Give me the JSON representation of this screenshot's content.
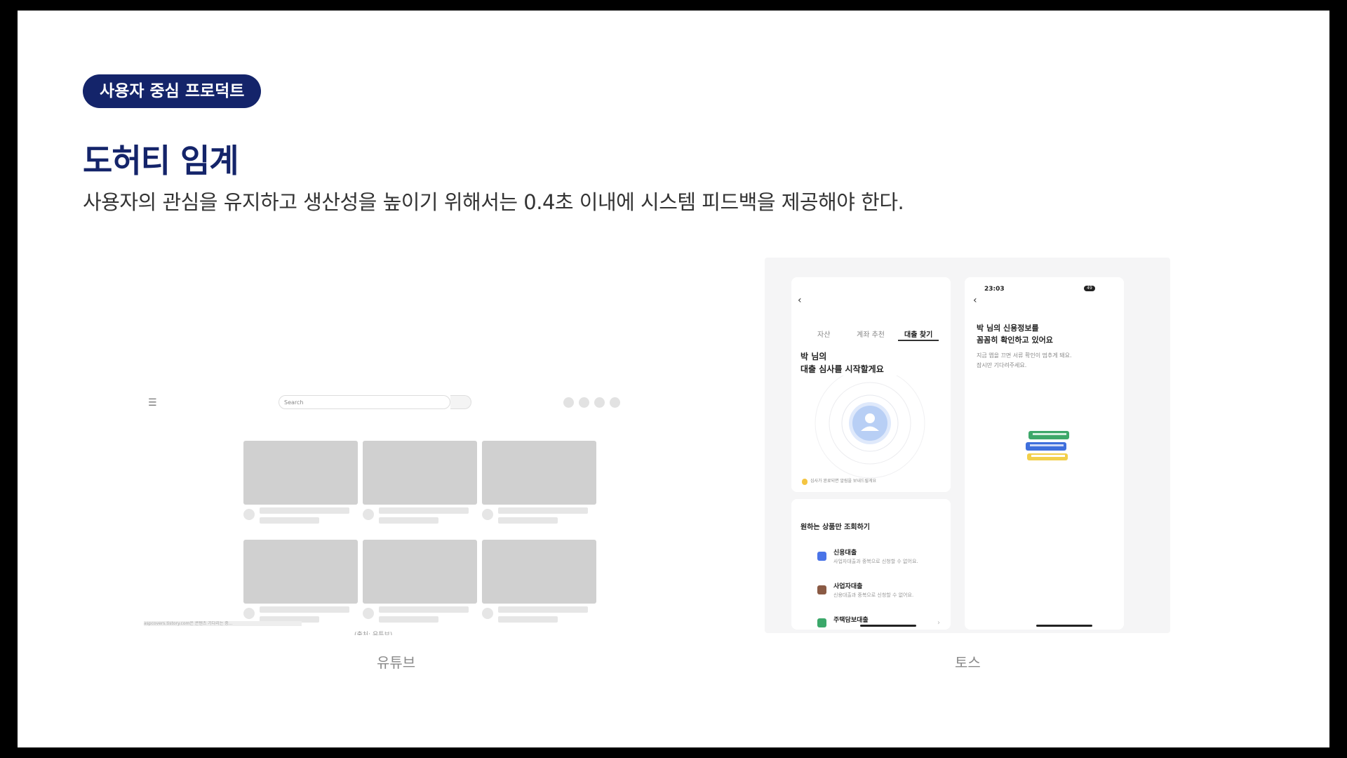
{
  "badge": "사용자 중심 프로덕트",
  "title": "도허티 임계",
  "subtitle": "사용자의 관심을 유지하고 생산성을 높이기 위해서는 0.4초 이내에 시스템 피드백을 제공해야 한다.",
  "youtube": {
    "caption": "유튜브",
    "search_placeholder": "Search",
    "menu_icon": "menu-icon",
    "footer_text": "aspcovers.tistory.com은 콘텐츠 기다리는 중...",
    "source_text": "(출처: 유튜브)"
  },
  "toss": {
    "caption": "토스",
    "left": {
      "tabs": [
        "자산",
        "계좌 추천",
        "대출 찾기"
      ],
      "active_tab": "대출 찾기",
      "heading_line1": "박    님의",
      "heading_line2": "대출 심사를 시작할게요",
      "notice": "심사가 완료되면 알림을 보내드릴게요",
      "section_title": "원하는 상품만 조회하기",
      "items": [
        {
          "title": "신용대출",
          "desc": "사업자대출과 중복으로 신청할 수 없어요."
        },
        {
          "title": "사업자대출",
          "desc": "신용대출과 중복으로 신청할 수 없어요."
        },
        {
          "title": "주택담보대출",
          "desc": ""
        }
      ]
    },
    "right": {
      "time": "23:03",
      "battery": "49",
      "heading_line1": "박    님의 신용정보를",
      "heading_line2": "꼼꼼히 확인하고 있어요",
      "desc_line1": "지금 앱을 끄면 서류 확인이 멈추게 돼요.",
      "desc_line2": "잠시만 기다려주세요."
    },
    "colors": {
      "accent": "#3182f6",
      "badge": "#14246a"
    }
  }
}
